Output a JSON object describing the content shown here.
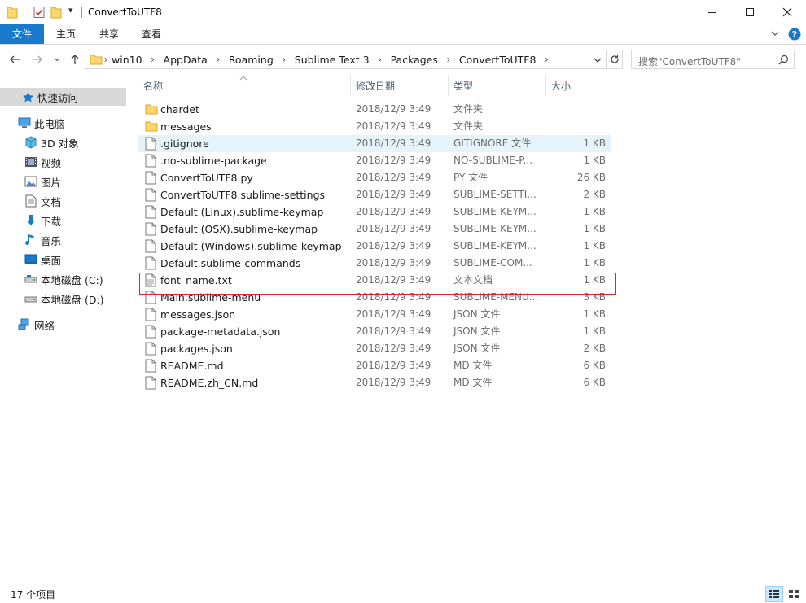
{
  "window": {
    "title": "ConvertToUTF8",
    "qa_dropdown": "▾"
  },
  "ribbon": {
    "tabs": [
      {
        "label": "文件",
        "active": true
      },
      {
        "label": "主页",
        "active": false
      },
      {
        "label": "共享",
        "active": false
      },
      {
        "label": "查看",
        "active": false
      }
    ]
  },
  "address": {
    "path": [
      "win10",
      "AppData",
      "Roaming",
      "Sublime Text 3",
      "Packages",
      "ConvertToUTF8"
    ],
    "separator": "›"
  },
  "search": {
    "placeholder": "搜索\"ConvertToUTF8\""
  },
  "nav": {
    "items": [
      {
        "label": "快速访问",
        "icon": "star-icon",
        "level": 0,
        "selected": true
      },
      {
        "label": "此电脑",
        "icon": "computer-icon",
        "level": 0,
        "selected": false
      },
      {
        "label": "3D 对象",
        "icon": "cube-icon",
        "level": 1,
        "selected": false
      },
      {
        "label": "视频",
        "icon": "video-icon",
        "level": 1,
        "selected": false
      },
      {
        "label": "图片",
        "icon": "picture-icon",
        "level": 1,
        "selected": false
      },
      {
        "label": "文档",
        "icon": "document-icon",
        "level": 1,
        "selected": false
      },
      {
        "label": "下载",
        "icon": "download-icon",
        "level": 1,
        "selected": false
      },
      {
        "label": "音乐",
        "icon": "music-icon",
        "level": 1,
        "selected": false
      },
      {
        "label": "桌面",
        "icon": "desktop-icon",
        "level": 1,
        "selected": false
      },
      {
        "label": "本地磁盘 (C:)",
        "icon": "drive-icon",
        "level": 1,
        "selected": false
      },
      {
        "label": "本地磁盘 (D:)",
        "icon": "drive-icon",
        "level": 1,
        "selected": false
      },
      {
        "label": "网络",
        "icon": "network-icon",
        "level": 0,
        "selected": false
      }
    ]
  },
  "columns": {
    "name": "名称",
    "date": "修改日期",
    "type": "类型",
    "size": "大小"
  },
  "files": [
    {
      "name": "chardet",
      "date": "2018/12/9 3:49",
      "type": "文件夹",
      "size": "",
      "kind": "folder"
    },
    {
      "name": "messages",
      "date": "2018/12/9 3:49",
      "type": "文件夹",
      "size": "",
      "kind": "folder"
    },
    {
      "name": ".gitignore",
      "date": "2018/12/9 3:49",
      "type": "GITIGNORE 文件",
      "size": "1 KB",
      "kind": "file",
      "hover": true
    },
    {
      "name": ".no-sublime-package",
      "date": "2018/12/9 3:49",
      "type": "NO-SUBLIME-P...",
      "size": "1 KB",
      "kind": "file"
    },
    {
      "name": "ConvertToUTF8.py",
      "date": "2018/12/9 3:49",
      "type": "PY 文件",
      "size": "26 KB",
      "kind": "file"
    },
    {
      "name": "ConvertToUTF8.sublime-settings",
      "date": "2018/12/9 3:49",
      "type": "SUBLIME-SETTI...",
      "size": "2 KB",
      "kind": "file"
    },
    {
      "name": "Default (Linux).sublime-keymap",
      "date": "2018/12/9 3:49",
      "type": "SUBLIME-KEYM...",
      "size": "1 KB",
      "kind": "file"
    },
    {
      "name": "Default (OSX).sublime-keymap",
      "date": "2018/12/9 3:49",
      "type": "SUBLIME-KEYM...",
      "size": "1 KB",
      "kind": "file"
    },
    {
      "name": "Default (Windows).sublime-keymap",
      "date": "2018/12/9 3:49",
      "type": "SUBLIME-KEYM...",
      "size": "1 KB",
      "kind": "file"
    },
    {
      "name": "Default.sublime-commands",
      "date": "2018/12/9 3:49",
      "type": "SUBLIME-COM...",
      "size": "1 KB",
      "kind": "file"
    },
    {
      "name": "font_name.txt",
      "date": "2018/12/9 3:49",
      "type": "文本文档",
      "size": "1 KB",
      "kind": "text"
    },
    {
      "name": "Main.sublime-menu",
      "date": "2018/12/9 3:49",
      "type": "SUBLIME-MENU...",
      "size": "3 KB",
      "kind": "file"
    },
    {
      "name": "messages.json",
      "date": "2018/12/9 3:49",
      "type": "JSON 文件",
      "size": "1 KB",
      "kind": "file"
    },
    {
      "name": "package-metadata.json",
      "date": "2018/12/9 3:49",
      "type": "JSON 文件",
      "size": "1 KB",
      "kind": "file"
    },
    {
      "name": "packages.json",
      "date": "2018/12/9 3:49",
      "type": "JSON 文件",
      "size": "2 KB",
      "kind": "file"
    },
    {
      "name": "README.md",
      "date": "2018/12/9 3:49",
      "type": "MD 文件",
      "size": "6 KB",
      "kind": "file"
    },
    {
      "name": "README.zh_CN.md",
      "date": "2018/12/9 3:49",
      "type": "MD 文件",
      "size": "6 KB",
      "kind": "file"
    }
  ],
  "status": {
    "count": "17 个项目"
  },
  "colors": {
    "accent": "#1979ca",
    "highlight_border": "#d7262e",
    "hover_row": "#e5f3fb",
    "folder": "#ffd76a"
  }
}
